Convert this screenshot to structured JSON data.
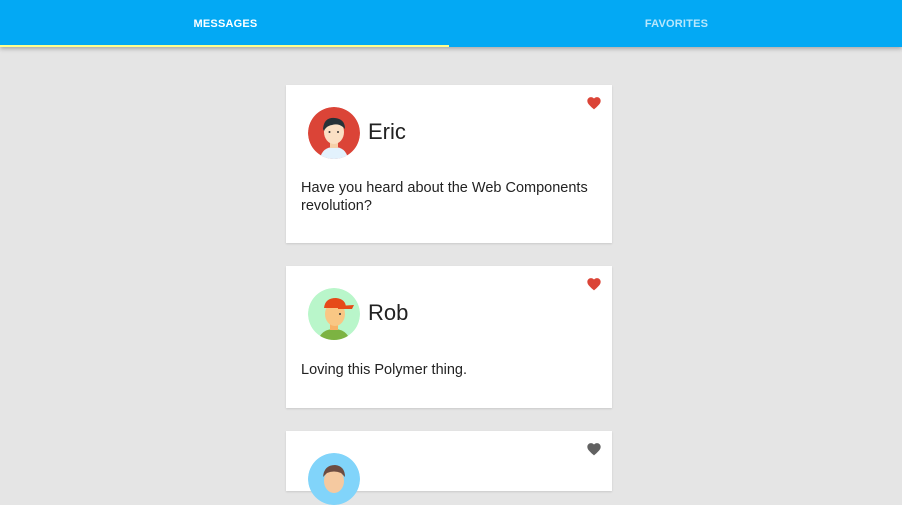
{
  "tabs": [
    {
      "label": "MESSAGES",
      "selected": true
    },
    {
      "label": "FAVORITES",
      "selected": false
    }
  ],
  "colors": {
    "toolbar": "#03a9f4",
    "background": "#e5e5e5",
    "tab_underline": "#ffff8d",
    "heart_favorite": "#db4437",
    "heart_default": "#616161"
  },
  "cards": [
    {
      "name": "Eric",
      "message": "Have you heard about the Web Components revolution?",
      "favorite": true,
      "avatar_icon": "avatar-eric-icon"
    },
    {
      "name": "Rob",
      "message": "Loving this Polymer thing.",
      "favorite": true,
      "avatar_icon": "avatar-rob-icon"
    },
    {
      "name": "",
      "message": "",
      "favorite": false,
      "avatar_icon": "avatar-icon"
    }
  ]
}
